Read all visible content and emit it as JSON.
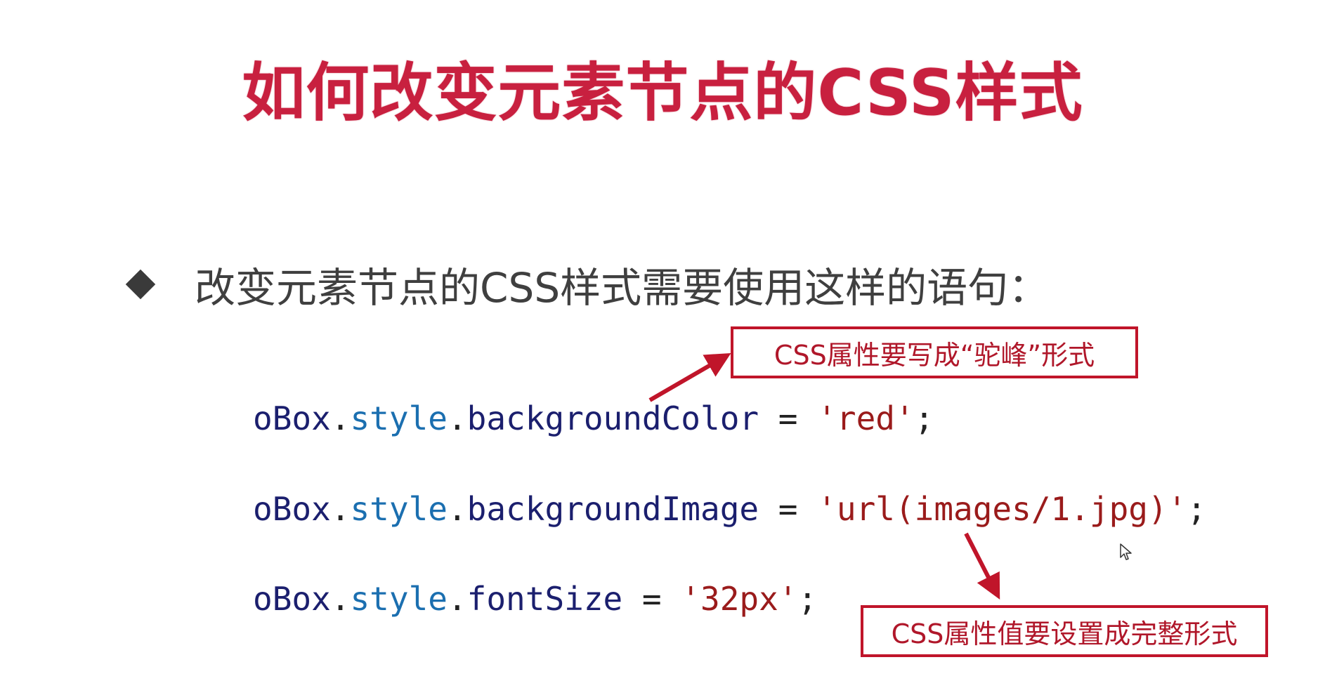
{
  "title": "如何改变元素节点的CSS样式",
  "bullet": "改变元素节点的CSS样式需要使用这样的语句：",
  "code": [
    {
      "obj": "oBox",
      "dot1": ".",
      "style": "style",
      "dot2": ".",
      "prop": "backgroundColor",
      "op": " = ",
      "value": "'red'",
      "end": ";"
    },
    {
      "obj": "oBox",
      "dot1": ".",
      "style": "style",
      "dot2": ".",
      "prop": "backgroundImage",
      "op": " = ",
      "value": "'url(images/1.jpg)'",
      "end": ";"
    },
    {
      "obj": "oBox",
      "dot1": ".",
      "style": "style",
      "dot2": ".",
      "prop": "fontSize",
      "op": " = ",
      "value": "'32px'",
      "end": ";"
    }
  ],
  "callouts": {
    "camel_case": "CSS属性要写成“驼峰”形式",
    "full_value": "CSS属性值要设置成完整形式"
  },
  "colors": {
    "title": "#c8203f",
    "accent_red": "#c0152a"
  },
  "icons": {
    "bullet": "diamond-icon",
    "pointer": "arrow-cursor-icon"
  }
}
